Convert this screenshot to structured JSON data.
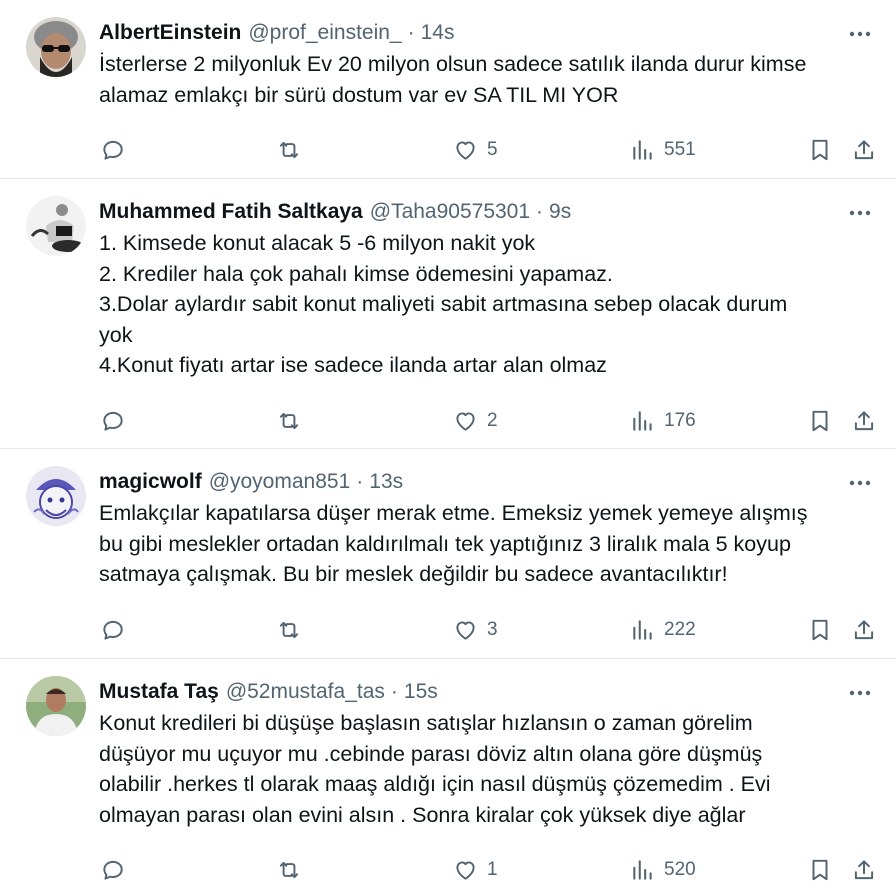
{
  "tweets": [
    {
      "name": "AlbertEinstein",
      "handle": "@prof_einstein_",
      "separator": "·",
      "time": "14s",
      "lines": [
        "İsterlerse 2 milyonluk Ev 20 milyon olsun sadece satılık ilanda durur kimse",
        "alamaz emlakçı bir sürü dostum var ev SA TIL MI YOR"
      ],
      "likes": "5",
      "views": "551",
      "avatar": "einstein-avatar"
    },
    {
      "name": "Muhammed Fatih Saltkaya",
      "handle": "@Taha90575301",
      "separator": "·",
      "time": "9s",
      "lines": [
        "1. Kimsede konut alacak 5 -6 milyon nakit yok",
        "2. Krediler hala çok pahalı kimse ödemesini yapamaz.",
        "3.Dolar aylardır sabit konut maliyeti sabit artmasına sebep olacak durum",
        "yok",
        "4.Konut fiyatı artar ise sadece ilanda artar alan olmaz"
      ],
      "likes": "2",
      "views": "176",
      "avatar": "saltkaya-avatar"
    },
    {
      "name": "magicwolf",
      "handle": "@yoyoman851",
      "separator": "·",
      "time": "13s",
      "lines": [
        "Emlakçılar kapatılarsa düşer merak etme. Emeksiz yemek yemeye alışmış",
        "bu gibi meslekler ortadan kaldırılmalı tek yaptığınız 3 liralık mala 5 koyup",
        "satmaya çalışmak. Bu bir meslek değildir bu sadece avantacılıktır!"
      ],
      "likes": "3",
      "views": "222",
      "avatar": "magicwolf-avatar"
    },
    {
      "name": "Mustafa Taş",
      "handle": "@52mustafa_tas",
      "separator": "·",
      "time": "15s",
      "lines": [
        "Konut kredileri bi düşüşe başlasın satışlar hızlansın o zaman görelim",
        "düşüyor mu uçuyor mu .cebinde parası döviz altın olana göre düşmüş",
        "olabilir .herkes tl olarak maaş aldığı için nasıl düşmüş çözemedim . Evi",
        "olmayan parası olan evini alsın . Sonra kiralar çok yüksek diye ağlar"
      ],
      "likes": "1",
      "views": "520",
      "avatar": "mustafa-avatar"
    }
  ],
  "icons": {
    "reply": "reply-icon",
    "retweet": "retweet-icon",
    "like": "heart-icon",
    "views": "views-icon",
    "bookmark": "bookmark-icon",
    "share": "share-icon",
    "more": "more-icon"
  },
  "colors": {
    "text": "#0f1419",
    "secondary": "#536471",
    "divider": "#e6e9eb"
  }
}
